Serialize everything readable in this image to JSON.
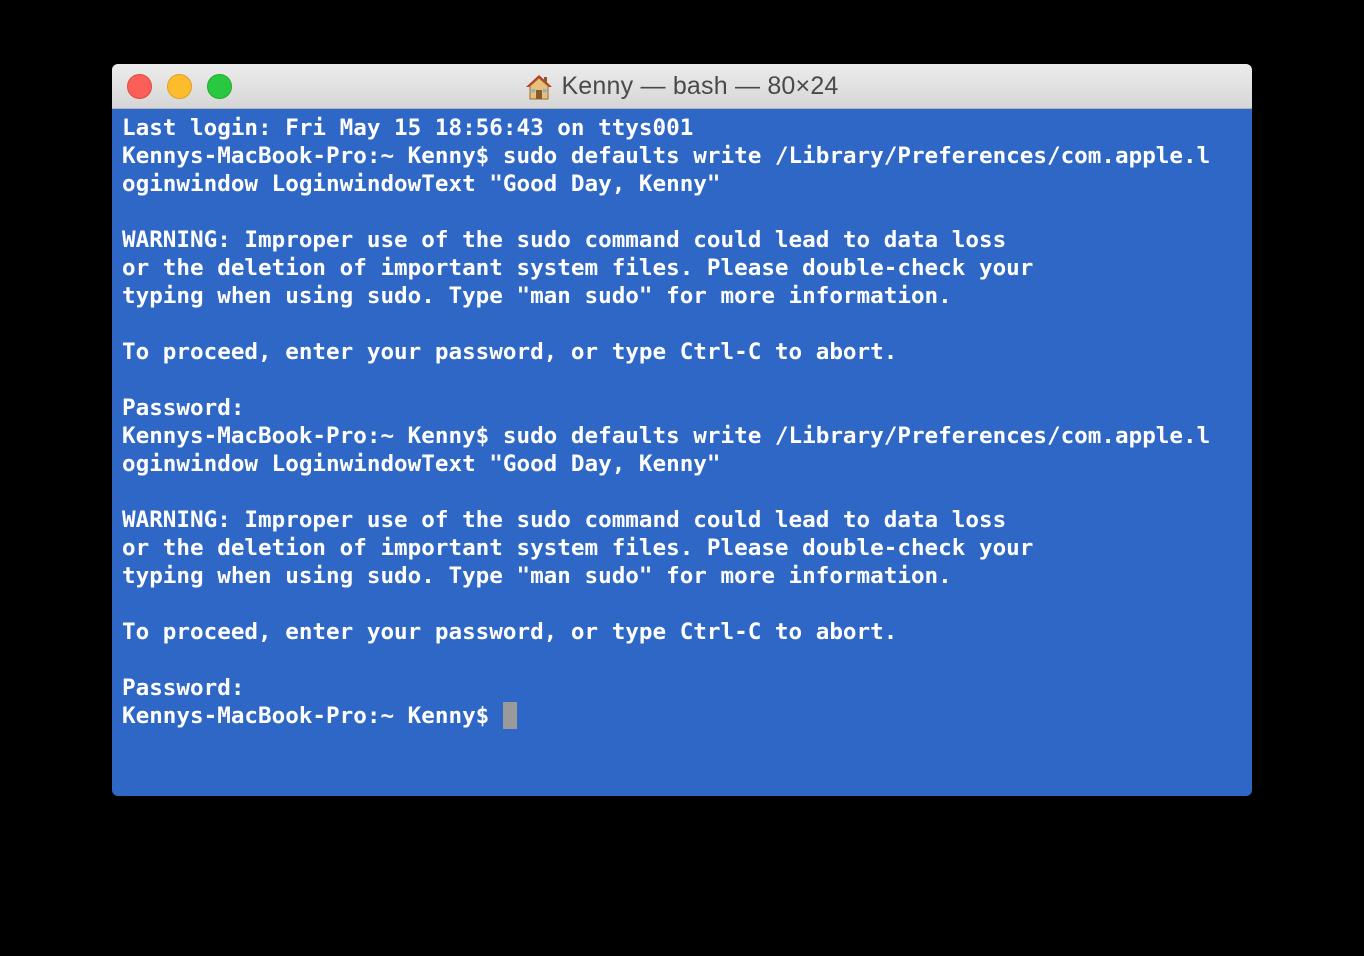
{
  "window": {
    "title": "Kenny — bash — 80×24",
    "title_icon": "home-icon",
    "background_color": "#2e67c6",
    "text_color": "#ffffff"
  },
  "terminal": {
    "lines": [
      "Last login: Fri May 15 18:56:43 on ttys001",
      "Kennys-MacBook-Pro:~ Kenny$ sudo defaults write /Library/Preferences/com.apple.l",
      "oginwindow LoginwindowText \"Good Day, Kenny\"",
      "",
      "WARNING: Improper use of the sudo command could lead to data loss",
      "or the deletion of important system files. Please double-check your",
      "typing when using sudo. Type \"man sudo\" for more information.",
      "",
      "To proceed, enter your password, or type Ctrl-C to abort.",
      "",
      "Password:",
      "Kennys-MacBook-Pro:~ Kenny$ sudo defaults write /Library/Preferences/com.apple.l",
      "oginwindow LoginwindowText \"Good Day, Kenny\"",
      "",
      "WARNING: Improper use of the sudo command could lead to data loss",
      "or the deletion of important system files. Please double-check your",
      "typing when using sudo. Type \"man sudo\" for more information.",
      "",
      "To proceed, enter your password, or type Ctrl-C to abort.",
      "",
      "Password:"
    ],
    "prompt": "Kennys-MacBook-Pro:~ Kenny$ "
  }
}
